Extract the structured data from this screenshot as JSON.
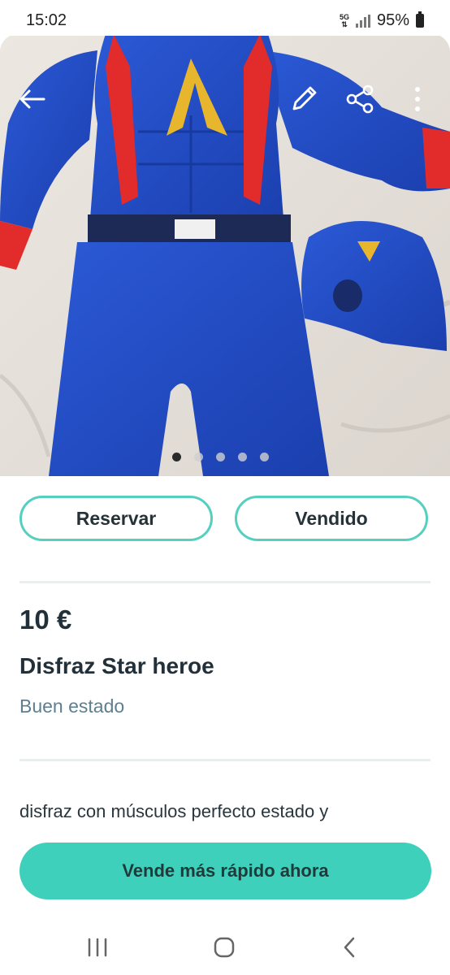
{
  "status_bar": {
    "time": "15:02",
    "network": "5G",
    "battery": "95%"
  },
  "gallery": {
    "icons": [
      "back-arrow-icon",
      "edit-pencil-icon",
      "share-icon",
      "more-vertical-icon"
    ],
    "dot_count": 5,
    "active_dot": 0
  },
  "actions": {
    "reserve_label": "Reservar",
    "sold_label": "Vendido"
  },
  "listing": {
    "price": "10 €",
    "title": "Disfraz Star heroe",
    "condition": "Buen estado",
    "description": "disfraz con músculos perfecto estado y"
  },
  "cta": {
    "label": "Vende más rápido ahora"
  },
  "colors": {
    "accent": "#3fd0bb",
    "outline": "#57cfc0",
    "text": "#22303a",
    "muted": "#5d7f8e"
  },
  "nav_bar": {
    "icons": [
      "recent-apps-icon",
      "home-icon",
      "back-icon"
    ]
  }
}
